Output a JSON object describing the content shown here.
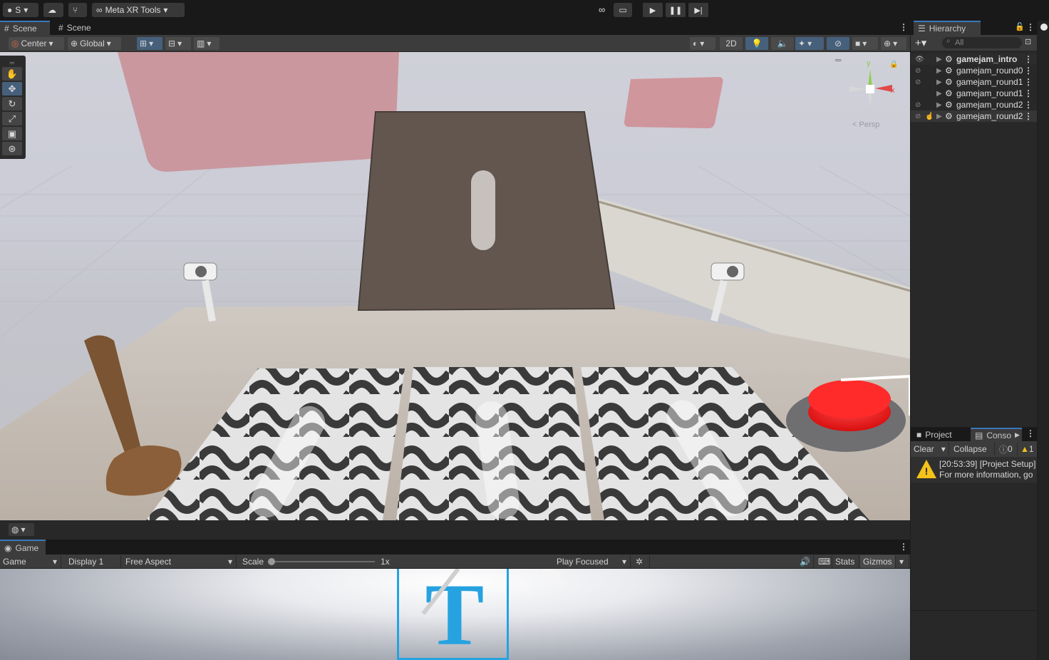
{
  "topbar": {
    "account": "S",
    "xr_tools": "Meta XR Tools"
  },
  "scene_tabs": [
    {
      "label": "Scene"
    },
    {
      "label": "Scene"
    }
  ],
  "scene_toolbar": {
    "pivot": "Center",
    "space": "Global",
    "mode_2d": "2D"
  },
  "gizmo": {
    "y": "y",
    "x": "x",
    "persp": "Persp"
  },
  "hierarchy": {
    "title": "Hierarchy",
    "search_placeholder": "All",
    "items": [
      {
        "label": "gamejam_intro",
        "bold": true
      },
      {
        "label": "gamejam_round0"
      },
      {
        "label": "gamejam_round1"
      },
      {
        "label": "gamejam_round1"
      },
      {
        "label": "gamejam_round2"
      },
      {
        "label": "gamejam_round2"
      }
    ]
  },
  "bottom_tabs": {
    "project": "Project",
    "console": "Conso"
  },
  "console": {
    "clear": "Clear",
    "collapse": "Collapse",
    "errors": "0",
    "warnings": "1",
    "message_line1": "[20:53:39] [Project Setup]",
    "message_line2": "For more information, go"
  },
  "game": {
    "tab": "Game",
    "view": "Game",
    "display": "Display 1",
    "aspect": "Free Aspect",
    "scale_label": "Scale",
    "scale_value": "1x",
    "play_focused": "Play Focused",
    "stats": "Stats",
    "gizmos": "Gizmos",
    "logo_letter": "T"
  },
  "colors": {
    "accent": "#3a79bb",
    "button_red": "#ee1c1c",
    "warning": "#f4c21a"
  }
}
